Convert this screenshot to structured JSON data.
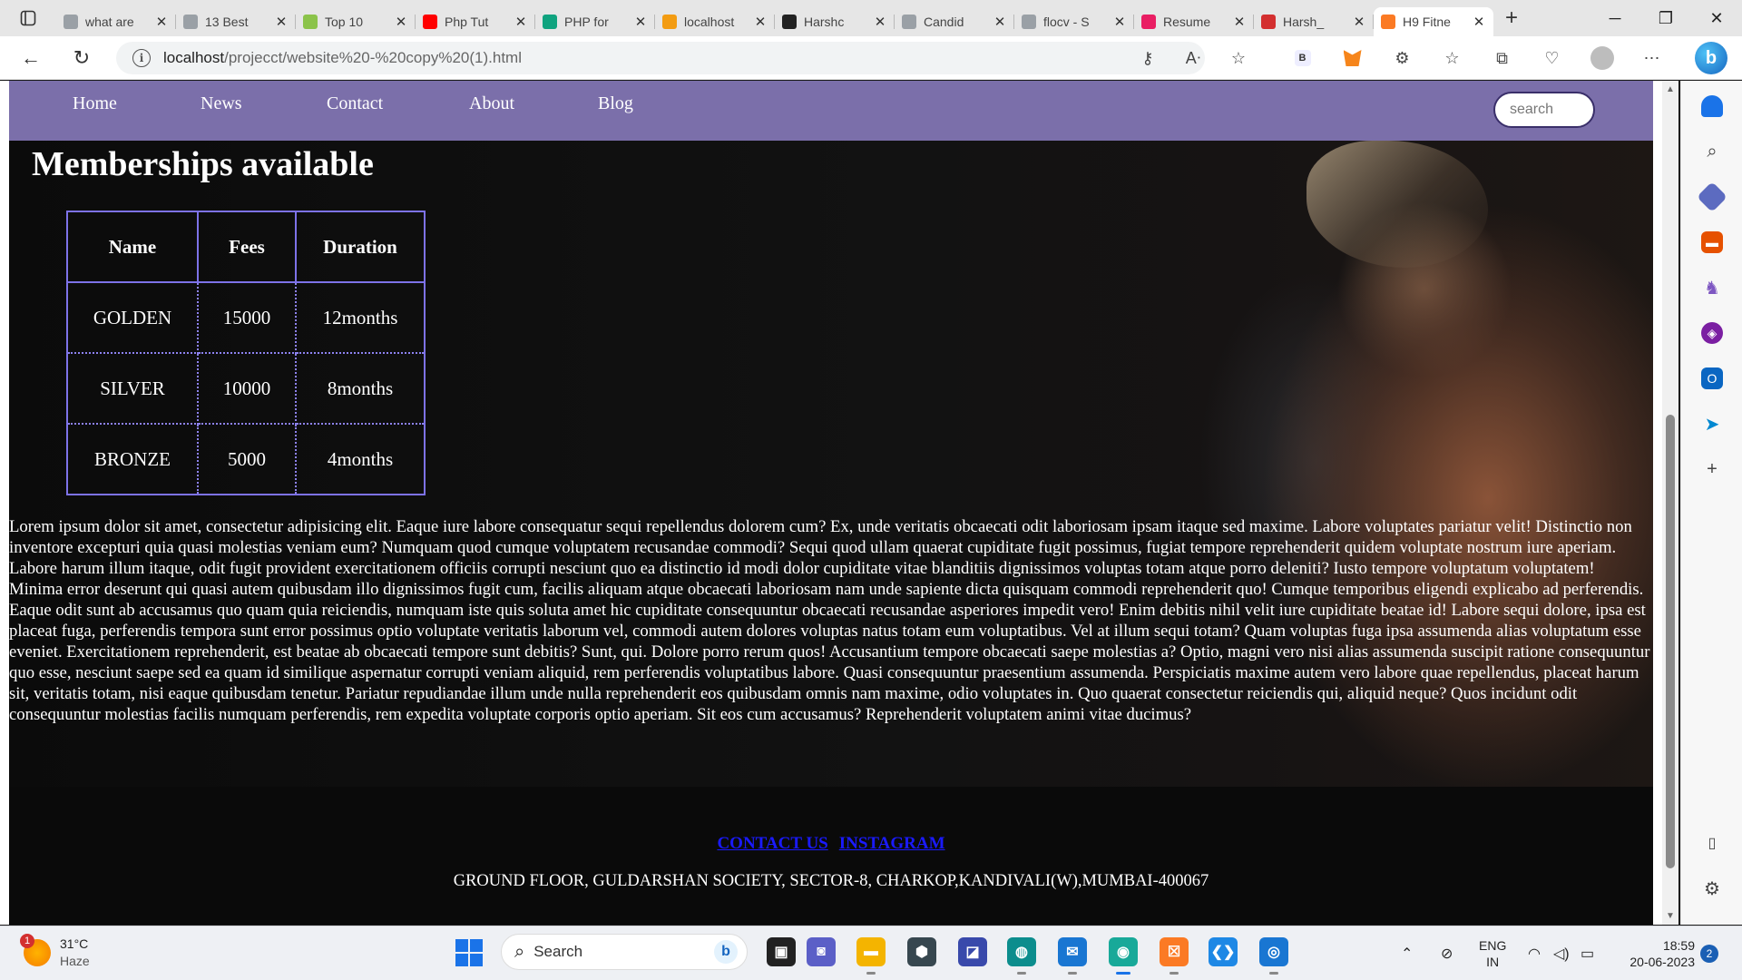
{
  "browser": {
    "tabs": [
      {
        "title": "what are",
        "icon": "search-icon",
        "color": "#9aa0a6"
      },
      {
        "title": "13 Best",
        "icon": "terminal-icon",
        "color": "#9aa0a6"
      },
      {
        "title": "Top 10",
        "icon": "logo-icon",
        "color": "#8bc34a"
      },
      {
        "title": "Php Tut",
        "icon": "youtube-icon",
        "color": "#ff0000"
      },
      {
        "title": "PHP for",
        "icon": "chatgpt-icon",
        "color": "#10a37f"
      },
      {
        "title": "localhost",
        "icon": "phpmyadmin-icon",
        "color": "#f39c12"
      },
      {
        "title": "Harshc",
        "icon": "github-icon",
        "color": "#222222"
      },
      {
        "title": "Candid",
        "icon": "document-icon",
        "color": "#9aa0a6"
      },
      {
        "title": "flocv - S",
        "icon": "search-icon",
        "color": "#9aa0a6"
      },
      {
        "title": "Resume",
        "icon": "resume-icon",
        "color": "#e91e63"
      },
      {
        "title": "Harsh_",
        "icon": "pdf-icon",
        "color": "#d32f2f"
      },
      {
        "title": "H9 Fitne",
        "icon": "xampp-icon",
        "color": "#fb7a24"
      }
    ],
    "url_host": "localhost",
    "url_path": "/projecct/website%20-%20copy%20(1).html",
    "win_minimize": "─",
    "win_maximize": "❐",
    "win_close": "✕"
  },
  "site": {
    "nav": [
      "Home",
      "News",
      "Contact",
      "About",
      "Blog"
    ],
    "search_placeholder": "search",
    "heading": "Memberships available",
    "table": {
      "headers": [
        "Name",
        "Fees",
        "Duration"
      ],
      "rows": [
        [
          "GOLDEN",
          "15000",
          "12months"
        ],
        [
          "SILVER",
          "10000",
          "8months"
        ],
        [
          "BRONZE",
          "5000",
          "4months"
        ]
      ]
    },
    "paragraph": "Lorem ipsum dolor sit amet, consectetur adipisicing elit. Eaque iure labore consequatur sequi repellendus dolorem cum? Ex, unde veritatis obcaecati odit laboriosam ipsam itaque sed maxime. Labore voluptates pariatur velit! Distinctio non inventore excepturi quia quasi molestias veniam eum? Numquam quod cumque voluptatem recusandae commodi? Sequi quod ullam quaerat cupiditate fugit possimus, fugiat tempore reprehenderit quidem voluptate nostrum iure aperiam. Labore harum illum itaque, odit fugit provident exercitationem officiis corrupti nesciunt quo ea distinctio id modi dolor cupiditate vitae blanditiis dignissimos voluptas totam atque porro deleniti? Iusto tempore voluptatum voluptatem! Minima error deserunt qui quasi autem quibusdam illo dignissimos fugit cum, facilis aliquam atque obcaecati laboriosam nam unde sapiente dicta quisquam commodi reprehenderit quo! Cumque temporibus eligendi explicabo ad perferendis. Eaque odit sunt ab accusamus quo quam quia reiciendis, numquam iste quis soluta amet hic cupiditate consequuntur obcaecati recusandae asperiores impedit vero! Enim debitis nihil velit iure cupiditate beatae id! Labore sequi dolore, ipsa est placeat fuga, perferendis tempora sunt error possimus optio voluptate veritatis laborum vel, commodi autem dolores voluptas natus totam eum voluptatibus. Vel at illum sequi totam? Quam voluptas fuga ipsa assumenda alias voluptatum esse eveniet. Exercitationem reprehenderit, est beatae ab obcaecati tempore sunt debitis? Sunt, qui. Dolore porro rerum quos! Accusantium tempore obcaecati saepe molestias a? Optio, magni vero nisi alias assumenda suscipit ratione consequuntur quo esse, nesciunt saepe sed ea quam id similique aspernatur corrupti veniam aliquid, rem perferendis voluptatibus labore. Quasi consequuntur praesentium assumenda. Perspiciatis maxime autem vero labore quae repellendus, placeat harum sit, veritatis totam, nisi eaque quibusdam tenetur. Pariatur repudiandae illum unde nulla reprehenderit eos quibusdam omnis nam maxime, odio voluptates in. Quo quaerat consectetur reiciendis qui, aliquid neque? Quos incidunt odit consequuntur molestias facilis numquam perferendis, rem expedita voluptate corporis optio aperiam. Sit eos cum accusamus? Reprehenderit voluptatem animi vitae ducimus?",
    "footer": {
      "contact_link": "CONTACT US",
      "instagram_link": "INSTAGRAM",
      "address": "GROUND FLOOR, GULDARSHAN SOCIETY, SECTOR-8, CHARKOP,KANDIVALI(W),MUMBAI-400067"
    }
  },
  "taskbar": {
    "weather_temp": "31°C",
    "weather_desc": "Haze",
    "weather_badge": "1",
    "search_label": "Search",
    "lang_line1": "ENG",
    "lang_line2": "IN",
    "time": "18:59",
    "date": "20-06-2023",
    "notifications": "2",
    "apps": [
      {
        "name": "task-view-icon",
        "color": "#222222",
        "glyph": "▣"
      },
      {
        "name": "teams-icon",
        "color": "#5b5fc7",
        "glyph": "◙"
      },
      {
        "name": "file-explorer-icon",
        "color": "#f4b400",
        "glyph": "▬"
      },
      {
        "name": "app-icon",
        "color": "#37474f",
        "glyph": "⬢"
      },
      {
        "name": "app-icon-2",
        "color": "#3949ab",
        "glyph": "◪"
      },
      {
        "name": "edge-icon",
        "color": "#0c8d8d",
        "glyph": "◍"
      },
      {
        "name": "mail-icon",
        "color": "#1976d2",
        "glyph": "✉"
      },
      {
        "name": "edge-dev-icon",
        "color": "#18a999",
        "glyph": "◉"
      },
      {
        "name": "xampp-icon",
        "color": "#fb7a24",
        "glyph": "☒"
      },
      {
        "name": "vscode-icon",
        "color": "#1e88e5",
        "glyph": "❮❯"
      },
      {
        "name": "app-icon-3",
        "color": "#1976d2",
        "glyph": "◎"
      }
    ]
  },
  "sidebar_icons": [
    "bell-icon",
    "search-icon",
    "tag-icon",
    "briefcase-icon",
    "chess-icon",
    "copilot-icon",
    "outlook-icon",
    "send-icon",
    "add-icon"
  ]
}
